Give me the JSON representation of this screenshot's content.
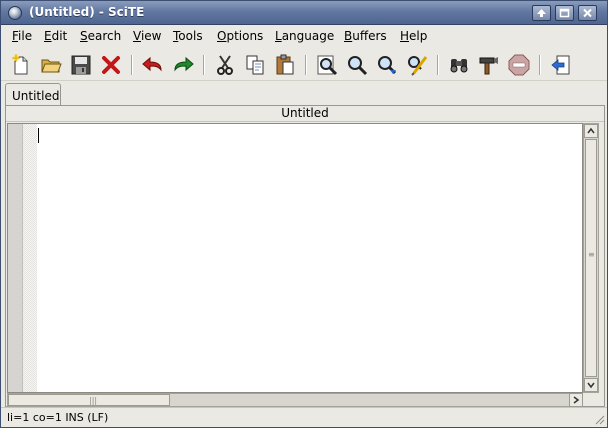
{
  "window": {
    "title": "(Untitled) - SciTE",
    "controls": [
      "maximize-arrow-icon",
      "restore-icon",
      "close-icon"
    ]
  },
  "menu": {
    "items": [
      {
        "label": "File",
        "mnemonic": "F",
        "rest": "ile"
      },
      {
        "label": "Edit",
        "mnemonic": "E",
        "rest": "dit"
      },
      {
        "label": "Search",
        "mnemonic": "S",
        "rest": "earch"
      },
      {
        "label": "View",
        "mnemonic": "V",
        "rest": "iew"
      },
      {
        "label": "Tools",
        "mnemonic": "T",
        "rest": "ools"
      },
      {
        "label": "Options",
        "mnemonic": "O",
        "rest": "ptions"
      },
      {
        "label": "Language",
        "mnemonic": "L",
        "rest": "anguage"
      },
      {
        "label": "Buffers",
        "mnemonic": "B",
        "rest": "uffers"
      },
      {
        "label": "Help",
        "mnemonic": "H",
        "rest": "elp"
      }
    ]
  },
  "toolbar": {
    "buttons": [
      "new-file-icon",
      "open-folder-icon",
      "save-icon",
      "close-file-icon",
      "undo-icon",
      "redo-icon",
      "cut-icon",
      "copy-icon",
      "paste-icon",
      "find-icon",
      "find-next-icon",
      "find-in-files-icon",
      "replace-icon",
      "binoculars-icon",
      "build-icon",
      "stop-icon",
      "previous-buffer-icon"
    ]
  },
  "tabs": [
    {
      "label": "Untitled",
      "active": true
    }
  ],
  "document": {
    "header": "Untitled",
    "content": ""
  },
  "status": {
    "text": "li=1 co=1 INS (LF)"
  },
  "colors": {
    "titlebar": "#6278a2",
    "window_bg": "#ebe9e4",
    "undo_red": "#c81d1d",
    "redo_green": "#1f8a2a"
  }
}
